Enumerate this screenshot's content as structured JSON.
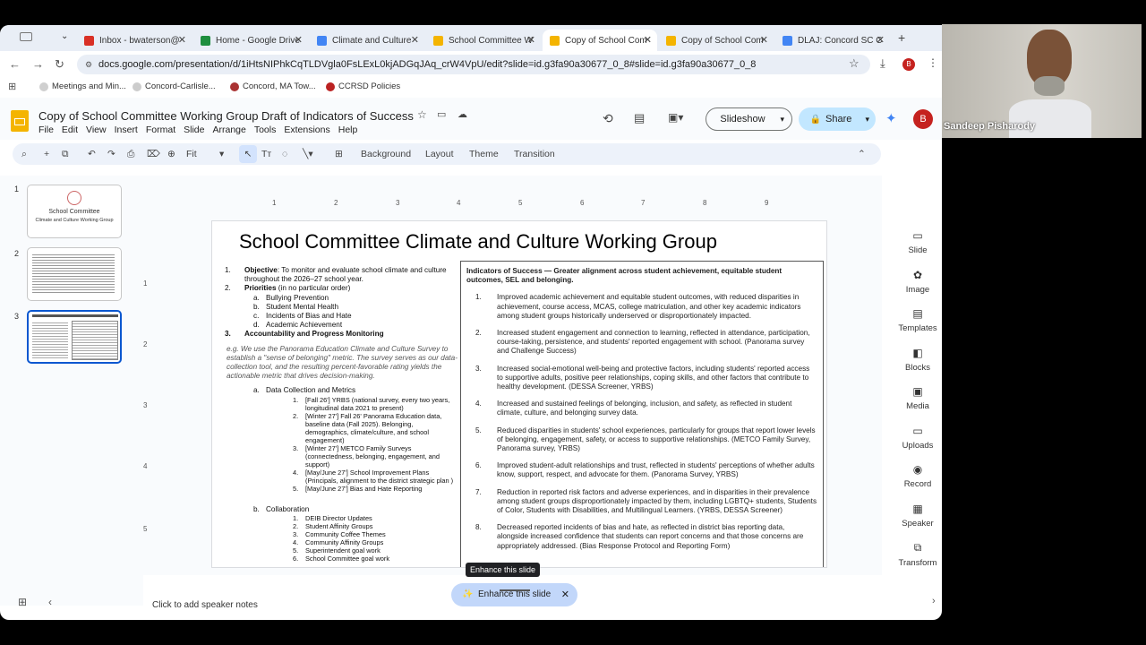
{
  "tabs": [
    {
      "label": "Inbox - bwaterson@",
      "color": "#d93025"
    },
    {
      "label": "Home - Google Drive",
      "color": "#1e8e3e"
    },
    {
      "label": "Climate and Culture",
      "color": "#4285f4"
    },
    {
      "label": "School Committee W",
      "color": "#f4b400"
    },
    {
      "label": "Copy of School Com",
      "color": "#f4b400"
    },
    {
      "label": "Copy of School Com",
      "color": "#f4b400"
    },
    {
      "label": "DLAJ: Concord SC C",
      "color": "#4285f4"
    }
  ],
  "url": "docs.google.com/presentation/d/1iHtsNIPhkCqTLDVgla0FsLExL0kjADGqJAq_crW4VpU/edit?slide=id.g3fa90a30677_0_8#slide=id.g3fa90a30677_0_8",
  "bookmarks": [
    "Meetings and Min...",
    "Concord-Carlisle...",
    "Concord, MA Tow...",
    "CCRSD Policies"
  ],
  "doc": {
    "title": "Copy of School Committee Working Group Draft of Indicators of Success",
    "menus": [
      "File",
      "Edit",
      "View",
      "Insert",
      "Format",
      "Slide",
      "Arrange",
      "Tools",
      "Extensions",
      "Help"
    ],
    "slideshow": "Slideshow",
    "share": "Share",
    "avatar": "B"
  },
  "toolbar": {
    "zoom": "Fit",
    "items": [
      "Background",
      "Layout",
      "Theme",
      "Transition"
    ]
  },
  "thumbnails": {
    "nums": [
      "1",
      "2",
      "3"
    ],
    "t1a": "School Committee",
    "t1b": "Climate and Culture Working Group"
  },
  "ruler": {
    "h": [
      "1",
      "2",
      "3",
      "4",
      "5",
      "6",
      "7",
      "8",
      "9"
    ],
    "v": [
      "1",
      "2",
      "3",
      "4",
      "5"
    ]
  },
  "slide": {
    "title": "School Committee Climate and Culture Working Group",
    "objective_label": "Objective",
    "objective": ": To monitor and evaluate school climate and culture throughout the 2026–27 school year.",
    "priorities_label": "Priorities",
    "priorities_note": " (in no particular order)",
    "priorities": [
      "Bullying Prevention",
      "Student Mental Health",
      "Incidents of Bias and Hate",
      "Academic Achievement"
    ],
    "accountability": "Accountability and Progress Monitoring",
    "italic_note": "e.g. We use the Panorama Education Climate and Culture Survey to establish a \"sense of belonging\" metric. The survey serves as our data-collection tool, and the resulting percent-favorable rating yields the actionable metric that drives decision-making.",
    "dc_label": "Data Collection and Metrics",
    "dc_items": [
      "[Fall 26'] YRBS (national survey, every two years, longitudinal data 2021 to present)",
      "[Winter 27'] Fall 26' Panorama Education data, baseline data (Fall 2025). Belonging, demographics, climate/culture, and school engagement)",
      "[Winter 27'] METCO Family Surveys (connectedness, belonging, engagement, and support)",
      "[May/June 27'] School Improvement Plans (Principals, alignment to the district strategic plan )",
      "[May/June 27'] Bias and Hate Reporting"
    ],
    "collab_label": "Collaboration",
    "collab_items": [
      "DEIB Director Updates",
      "Student Affinity Groups",
      "Community Coffee Themes",
      "Community Affinity Groups",
      "Superintendent goal work",
      "School Committee goal work"
    ],
    "ind_header": "Indicators of Success — Greater alignment across student achievement, equitable student outcomes, SEL and belonging.",
    "indicators": [
      "Improved academic achievement and equitable student outcomes, with reduced disparities in achievement, course access, MCAS, college matriculation, and other key academic indicators among student groups historically underserved or disproportionately impacted.",
      "Increased student engagement and connection to learning, reflected in attendance, participation, course-taking, persistence, and students' reported engagement with school. (Panorama survey and Challenge Success)",
      "Increased social-emotional well-being and protective factors, including students' reported access to supportive adults, positive peer relationships, coping skills, and other factors that contribute to healthy development. (DESSA Screener, YRBS)",
      "Increased and sustained feelings of belonging, inclusion, and safety, as reflected in student climate, culture, and belonging survey data.",
      "Reduced disparities in students' school experiences, particularly for groups that report lower levels of belonging, engagement, safety, or access to supportive relationships. (METCO Family Survey, Panorama survey, YRBS)",
      "Improved student-adult relationships and trust, reflected in students' perceptions of whether adults know, support, respect, and advocate for them. (Panorama Survey, YRBS)",
      "Reduction in reported risk factors and adverse experiences, and in disparities in their prevalence among student groups disproportionately impacted by them, including LGBTQ+ students, Students of Color, Students with Disabilities, and Multilingual Learners. (YRBS, DESSA Screener)",
      "Decreased reported incidents of bias and hate, as reflected in district bias reporting data, alongside increased confidence that students can report concerns and that those concerns are appropriately addressed. (Bias Response Protocol and Reporting Form)"
    ]
  },
  "tooltip": "Enhance this slide",
  "enhance": "Enhance this slide",
  "notes": "Click to add speaker notes",
  "side": [
    "Slide",
    "Image",
    "Templates",
    "Blocks",
    "Media",
    "Uploads",
    "Record",
    "Speaker",
    "Transform"
  ],
  "video_name": "Sandeep Pisharody"
}
